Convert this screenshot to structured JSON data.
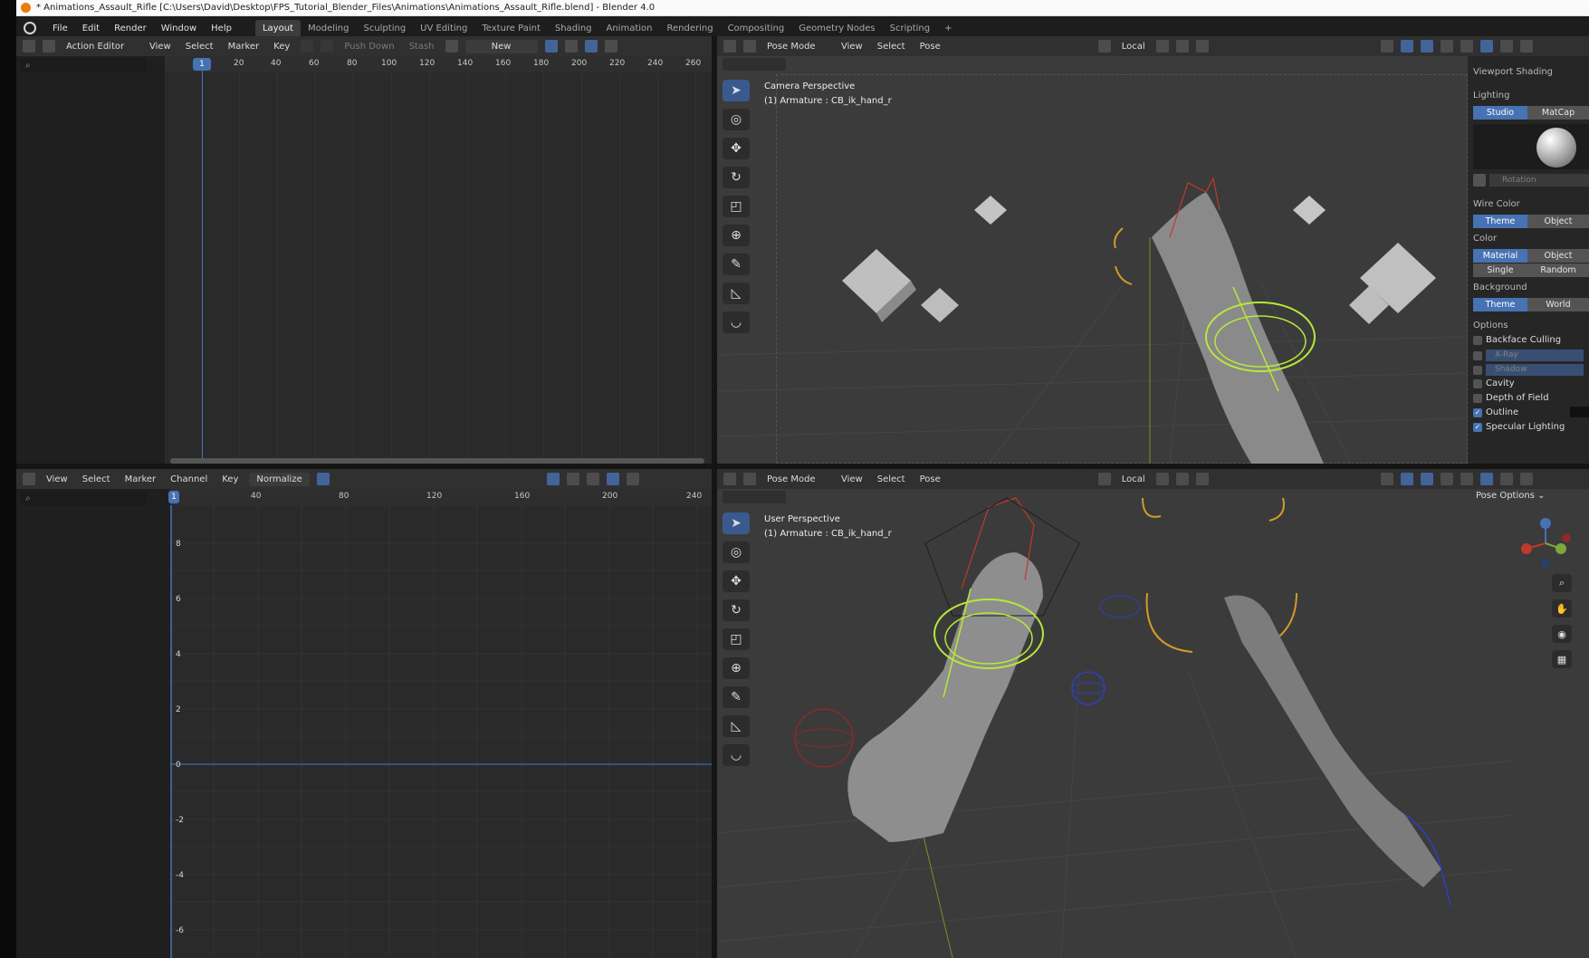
{
  "window": {
    "title": "* Animations_Assault_Rifle [C:\\Users\\David\\Desktop\\FPS_Tutorial_Blender_Files\\Animations\\Animations_Assault_Rifle.blend] - Blender 4.0"
  },
  "menu": {
    "items": [
      "File",
      "Edit",
      "Render",
      "Window",
      "Help"
    ]
  },
  "workspaces": [
    "Layout",
    "Modeling",
    "Sculpting",
    "UV Editing",
    "Texture Paint",
    "Shading",
    "Animation",
    "Rendering",
    "Compositing",
    "Geometry Nodes",
    "Scripting",
    "+"
  ],
  "action_editor": {
    "mode": "Action Editor",
    "menus": [
      "View",
      "Select",
      "Marker",
      "Key"
    ],
    "push_down": "Push Down",
    "stash": "Stash",
    "new_label": "New",
    "current_frame": "1",
    "ruler": [
      "20",
      "40",
      "60",
      "80",
      "100",
      "120",
      "140",
      "160",
      "180",
      "200",
      "220",
      "240",
      "260"
    ]
  },
  "graph_editor": {
    "menus": [
      "View",
      "Select",
      "Marker",
      "Channel",
      "Key"
    ],
    "normalize": "Normalize",
    "current_frame": "1",
    "ruler": [
      "40",
      "80",
      "120",
      "160",
      "200",
      "240"
    ],
    "y_labels": [
      "8",
      "6",
      "4",
      "2",
      "0",
      "-2",
      "-4",
      "-6"
    ]
  },
  "viewport_top": {
    "mode": "Pose Mode",
    "menus": [
      "View",
      "Select",
      "Pose"
    ],
    "orientation": "Local",
    "perspective": "Camera Perspective",
    "object": "(1) Armature : CB_ik_hand_r"
  },
  "viewport_bottom": {
    "mode": "Pose Mode",
    "menus": [
      "View",
      "Select",
      "Pose"
    ],
    "orientation": "Local",
    "perspective": "User Perspective",
    "object": "(1) Armature : CB_ik_hand_r",
    "pose_options": "Pose Options"
  },
  "shading_panel": {
    "title": "Viewport Shading",
    "lighting_label": "Lighting",
    "lighting": [
      "Studio",
      "MatCap"
    ],
    "rotation": "Rotation",
    "wire_color_label": "Wire Color",
    "wire_color": [
      "Theme",
      "Object"
    ],
    "color_label": "Color",
    "color_row1": [
      "Material",
      "Object"
    ],
    "color_row2": [
      "Single",
      "Random"
    ],
    "background_label": "Background",
    "background": [
      "Theme",
      "World"
    ],
    "options_label": "Options",
    "backface": "Backface Culling",
    "xray": "X-Ray",
    "shadow": "Shadow",
    "cavity": "Cavity",
    "dof": "Depth of Field",
    "outline": "Outline",
    "specular": "Specular Lighting"
  },
  "colors": {
    "accent": "#4772b3",
    "bone_ik": "#b7e83a",
    "bone_red": "#c0392b",
    "ring_orange": "#d19a2a",
    "bone_blue": "#2f3fc0"
  }
}
